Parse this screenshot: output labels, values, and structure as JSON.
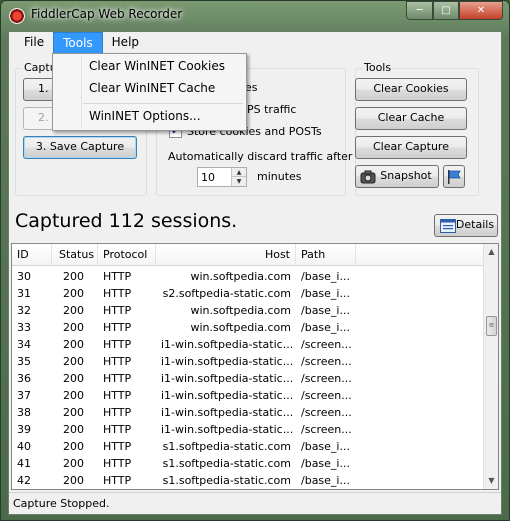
{
  "window": {
    "title": "FiddlerCap Web Recorder"
  },
  "menu": {
    "items": [
      "File",
      "Tools",
      "Help"
    ]
  },
  "tools_menu": {
    "items": [
      "Clear WinINET Cookies",
      "Clear WinINET Cache",
      "WinINET Options..."
    ]
  },
  "capture_group": {
    "title": "Captu",
    "btn1": "1. S",
    "btn2": "2. S",
    "save_capture": "3. Save Capture"
  },
  "options_group": {
    "opt1": "es",
    "opt2": "PS traffic",
    "store_cookies": "Store cookies and POSTs",
    "discard_label": "Automatically discard traffic after",
    "discard_minutes": "10",
    "minutes_label": "minutes"
  },
  "tools_group": {
    "title": "Tools",
    "clear_cookies": "Clear Cookies",
    "clear_cache": "Clear Cache",
    "clear_capture": "Clear Capture",
    "snapshot": "Snapshot"
  },
  "summary": {
    "captured_text": "Captured 112 sessions.",
    "details_label": "Details"
  },
  "list": {
    "columns": [
      "ID",
      "Status",
      "Protocol",
      "Host",
      "Path"
    ],
    "rows": [
      [
        "30",
        "200",
        "HTTP",
        "win.softpedia.com",
        "/base_i..."
      ],
      [
        "31",
        "200",
        "HTTP",
        "s2.softpedia-static.com",
        "/base_i..."
      ],
      [
        "32",
        "200",
        "HTTP",
        "win.softpedia.com",
        "/base_i..."
      ],
      [
        "33",
        "200",
        "HTTP",
        "win.softpedia.com",
        "/base_i..."
      ],
      [
        "34",
        "200",
        "HTTP",
        "i1-win.softpedia-static...",
        "/screen..."
      ],
      [
        "35",
        "200",
        "HTTP",
        "i1-win.softpedia-static...",
        "/screen..."
      ],
      [
        "36",
        "200",
        "HTTP",
        "i1-win.softpedia-static...",
        "/screen..."
      ],
      [
        "37",
        "200",
        "HTTP",
        "i1-win.softpedia-static...",
        "/screen..."
      ],
      [
        "38",
        "200",
        "HTTP",
        "i1-win.softpedia-static...",
        "/screen..."
      ],
      [
        "39",
        "200",
        "HTTP",
        "i1-win.softpedia-static...",
        "/screen..."
      ],
      [
        "40",
        "200",
        "HTTP",
        "s1.softpedia-static.com",
        "/base_i..."
      ],
      [
        "41",
        "200",
        "HTTP",
        "s1.softpedia-static.com",
        "/base_i..."
      ],
      [
        "42",
        "200",
        "HTTP",
        "s1.softpedia-static.com",
        "/base_i..."
      ]
    ]
  },
  "status": {
    "text": "Capture Stopped."
  }
}
